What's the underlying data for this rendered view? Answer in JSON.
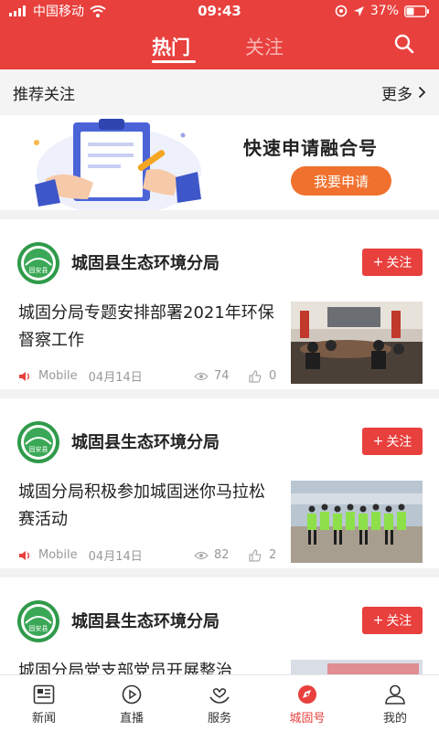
{
  "status": {
    "carrier": "中国移动",
    "time": "09:43",
    "battery": "37%"
  },
  "header": {
    "tab_active": "热门",
    "tab_inactive": "关注"
  },
  "recommend": {
    "title": "推荐关注",
    "more": "更多"
  },
  "banner": {
    "title": "快速申请融合号",
    "button": "我要申请"
  },
  "follow_label": "关注",
  "logo_text": "固安县",
  "articles": [
    {
      "source": "城固县生态环境分局",
      "headline": "城固分局专题安排部署2021年环保督察工作",
      "publisher": "Mobile",
      "date": "04月14日",
      "views": "74",
      "likes": "0"
    },
    {
      "source": "城固县生态环境分局",
      "headline": "城固分局积极参加城固迷你马拉松赛活动",
      "publisher": "Mobile",
      "date": "04月14日",
      "views": "82",
      "likes": "2"
    },
    {
      "source": "城固县生态环境分局",
      "headline": "城固分局党支部党员开展整治"
    }
  ],
  "nav": [
    {
      "label": "新闻",
      "icon": "news-icon"
    },
    {
      "label": "直播",
      "icon": "live-play-icon"
    },
    {
      "label": "服务",
      "icon": "service-icon"
    },
    {
      "label": "城固号",
      "icon": "compass-icon",
      "active": true
    },
    {
      "label": "我的",
      "icon": "profile-icon"
    }
  ],
  "colors": {
    "brand_red": "#e8403d",
    "apply_orange": "#f0712d"
  }
}
